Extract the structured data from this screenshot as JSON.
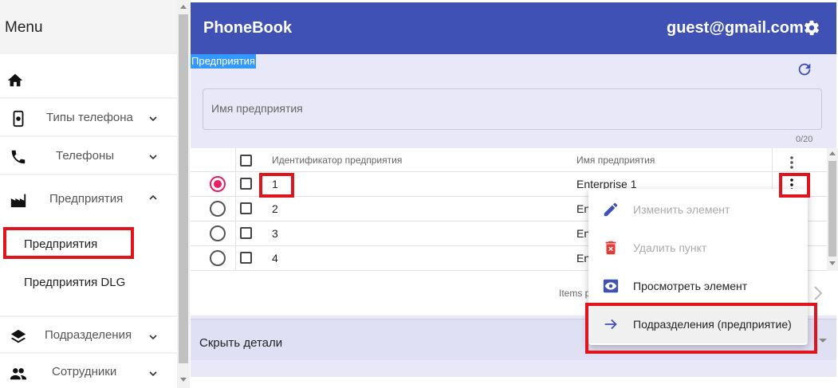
{
  "sidebar": {
    "header": "Menu",
    "items": [
      {
        "label": ""
      },
      {
        "label": "Типы телефона"
      },
      {
        "label": "Телефоны"
      },
      {
        "label": "Предприятия"
      },
      {
        "label": "Подразделения"
      },
      {
        "label": "Сотрудники"
      }
    ],
    "subitems": [
      "Предприятия",
      "Предприятия DLG"
    ]
  },
  "appbar": {
    "title": "PhoneBook",
    "user": "guest@gmail.com"
  },
  "breadcrumb": "Предприятия",
  "filter": {
    "placeholder": "Имя предприятия",
    "counter": "0/20"
  },
  "table": {
    "headers": [
      "Идентификатор предприятия",
      "Имя предприятия"
    ],
    "rows": [
      {
        "id": "1",
        "name": "Enterprise 1",
        "selected": true
      },
      {
        "id": "2",
        "name": "En",
        "selected": false
      },
      {
        "id": "3",
        "name": "En",
        "selected": false
      },
      {
        "id": "4",
        "name": "En",
        "selected": false
      }
    ]
  },
  "pager": {
    "items_label": "Items p"
  },
  "details": {
    "label": "Скрыть детали"
  },
  "context_menu": {
    "items": [
      {
        "label": "Изменить элемент",
        "icon": "pencil-icon",
        "disabled": true
      },
      {
        "label": "Удалить пункт",
        "icon": "trash-icon",
        "disabled": true
      },
      {
        "label": "Просмотреть элемент",
        "icon": "eye-icon",
        "disabled": false
      },
      {
        "label": "Подразделения (предприятие)",
        "icon": "arrow-right-icon",
        "disabled": false
      }
    ]
  },
  "colors": {
    "primary": "#3f51b5",
    "panel": "#e8e8f8",
    "accent": "#e91e63",
    "highlight": "#e0141c"
  }
}
